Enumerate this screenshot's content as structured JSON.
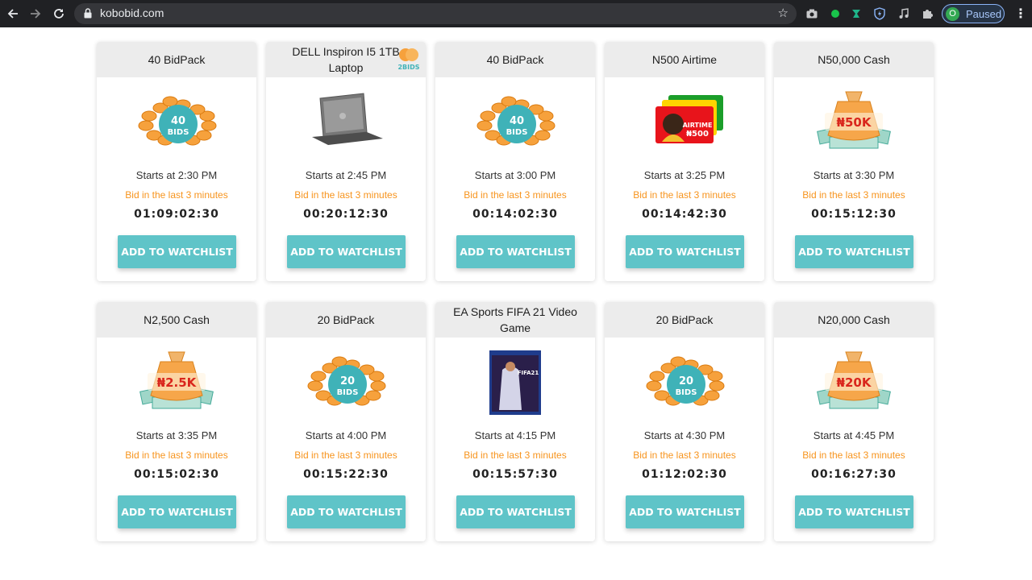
{
  "browser": {
    "url": "kobobid.com",
    "profile_initial": "O",
    "profile_status": "Paused",
    "icons": [
      "back-icon",
      "forward-icon",
      "reload-icon",
      "lock-icon",
      "star-icon",
      "camera-icon",
      "green-dot-icon",
      "extension-icon",
      "shield-icon",
      "music-icon",
      "puzzle-icon",
      "menu-icon"
    ]
  },
  "cards": [
    {
      "title": "40 BidPack",
      "image": "bidpack-40",
      "image_text": "40 BIDS",
      "starts": "Starts at 2:30 PM",
      "bid_note": "Bid in the last 3 minutes",
      "timer": "01:09:02:30",
      "button": "ADD TO WATCHLIST"
    },
    {
      "title": "DELL Inspiron I5 1TB Laptop",
      "image": "laptop",
      "badge": "2BIDS",
      "starts": "Starts at 2:45 PM",
      "bid_note": "Bid in the last 3 minutes",
      "timer": "00:20:12:30",
      "button": "ADD TO WATCHLIST"
    },
    {
      "title": "40 BidPack",
      "image": "bidpack-40",
      "image_text": "40 BIDS",
      "starts": "Starts at 3:00 PM",
      "bid_note": "Bid in the last 3 minutes",
      "timer": "00:14:02:30",
      "button": "ADD TO WATCHLIST"
    },
    {
      "title": "N500 Airtime",
      "image": "airtime",
      "image_text": "AIRTIME ₦500",
      "starts": "Starts at 3:25 PM",
      "bid_note": "Bid in the last 3 minutes",
      "timer": "00:14:42:30",
      "button": "ADD TO WATCHLIST"
    },
    {
      "title": "N50,000 Cash",
      "image": "cash-bag",
      "image_text": "₦50K",
      "starts": "Starts at 3:30 PM",
      "bid_note": "Bid in the last 3 minutes",
      "timer": "00:15:12:30",
      "button": "ADD TO WATCHLIST"
    },
    {
      "title": "N2,500 Cash",
      "image": "cash-bag",
      "image_text": "₦2.5K",
      "starts": "Starts at 3:35 PM",
      "bid_note": "Bid in the last 3 minutes",
      "timer": "00:15:02:30",
      "button": "ADD TO WATCHLIST"
    },
    {
      "title": "20 BidPack",
      "image": "bidpack-20",
      "image_text": "20 BIDS",
      "starts": "Starts at 4:00 PM",
      "bid_note": "Bid in the last 3 minutes",
      "timer": "00:15:22:30",
      "button": "ADD TO WATCHLIST"
    },
    {
      "title": "EA Sports FIFA 21 Video Game",
      "image": "fifa-game",
      "image_text": "FIFA21",
      "starts": "Starts at 4:15 PM",
      "bid_note": "Bid in the last 3 minutes",
      "timer": "00:15:57:30",
      "button": "ADD TO WATCHLIST"
    },
    {
      "title": "20 BidPack",
      "image": "bidpack-20",
      "image_text": "20 BIDS",
      "starts": "Starts at 4:30 PM",
      "bid_note": "Bid in the last 3 minutes",
      "timer": "01:12:02:30",
      "button": "ADD TO WATCHLIST"
    },
    {
      "title": "N20,000 Cash",
      "image": "cash-bag",
      "image_text": "₦20K",
      "starts": "Starts at 4:45 PM",
      "bid_note": "Bid in the last 3 minutes",
      "timer": "00:16:27:30",
      "button": "ADD TO WATCHLIST"
    }
  ],
  "colors": {
    "toolbar_bg": "#202124",
    "card_header_bg": "#ececec",
    "button_bg": "#5fc4c8",
    "bid_note": "#f7941d",
    "bidpack_teal": "#3fb2b8",
    "coin_orange": "#f6a13c",
    "cash_red": "#d9261c"
  }
}
